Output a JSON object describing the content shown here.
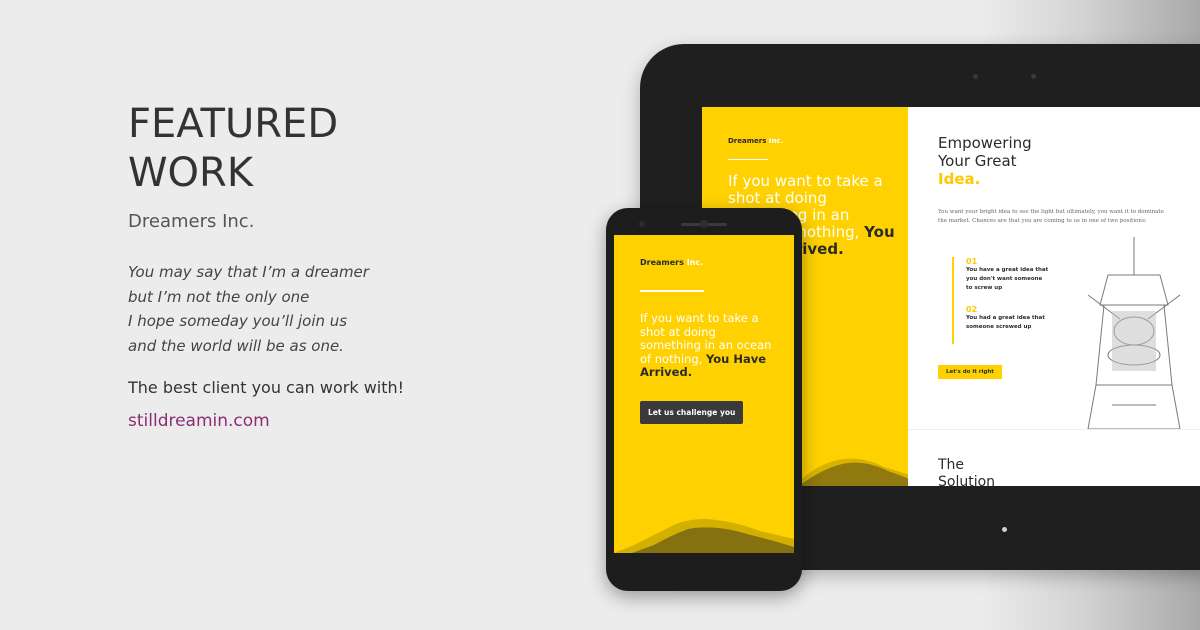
{
  "featured": {
    "heading_line1": "FEATURED",
    "heading_line2": "WORK",
    "client": "Dreamers Inc.",
    "quote_lines": [
      "You may say that I’m a dreamer",
      "but I’m not the only one",
      "I hope someday you’ll join us",
      "and the world will be as one."
    ],
    "tagline": "The best client you can work with!",
    "website": "stilldreamin.com"
  },
  "mockup": {
    "brand_name": "Dreamers",
    "brand_suffix": "Inc.",
    "hero_text": "If you want to take a shot at doing something in an ocean of nothing,",
    "hero_emphasis": "You Have Arrived.",
    "phone_button": "Let us challenge you",
    "tablet_title_line1": "Empowering",
    "tablet_title_line2": "Your Great",
    "tablet_title_accent": "Idea.",
    "tablet_body": "You want your bright idea to see the light but ultimately, you want it to dominate the market. Chances are that you are coming to us in one of two positions:",
    "list": [
      {
        "num": "01",
        "text": "You have a great idea that you don't want someone to screw up"
      },
      {
        "num": "02",
        "text": "You had a great idea that someone screwed up"
      }
    ],
    "tablet_button": "Let's do it right",
    "tablet_section2_line1": "The",
    "tablet_section2_line2": "Solution"
  },
  "colors": {
    "background": "#ececec",
    "brand_yellow": "#ffd100",
    "link": "#8a2e74",
    "device": "#1f1f1f"
  }
}
